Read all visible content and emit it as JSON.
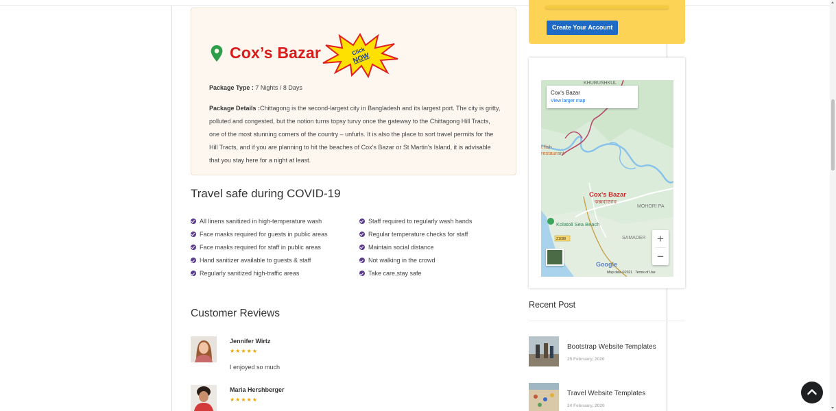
{
  "package": {
    "name": "Cox’s Bazar",
    "click_now_badge": "Click NOW",
    "type_label": "Package Type :",
    "type_value": "7 Nights / 8 Days",
    "details_label": "Package Details :",
    "details_text": "Chittagong is the second-largest city in Bangladesh and its largest port. The city is gritty, polluted and congested, but the notion turns topsy turvy once the gateway to the Chittagong Hill Tracts, one of the most stunning corners of the country – unfurls. It is also the place to sort travel permits for the Hill Tracts, and if you are planning to hit the beaches of Cox's Bazar or St Martin's Island, it is advisable that you stay here for a night at least."
  },
  "covid": {
    "title": "Travel safe during COVID-19",
    "left": [
      "All linens sanitized in high-temperature wash",
      "Face masks required for guests in public areas",
      "Face masks required for staff in public areas",
      "Hand sanitizer available to guests & staff",
      "Regularly sanitized high-traffic areas"
    ],
    "right": [
      "Staff required to regularly wash hands",
      "Regular temperature checks for staff",
      "Maintain social distance",
      "Not walking in the crowd",
      "Take care,stay safe"
    ]
  },
  "reviews": {
    "title": "Customer Reviews",
    "items": [
      {
        "name": "Jennifer Wirtz",
        "stars": "★★★★★",
        "rating": 5,
        "text": "I enjoyed so much"
      },
      {
        "name": "Maria Hershberger",
        "stars": "★★★★★",
        "rating": 5,
        "text": ""
      }
    ]
  },
  "sidebar": {
    "create_account_label": "Create Your Account",
    "map": {
      "info_title": "Cox's Bazar",
      "info_link": "View larger map",
      "labels": {
        "khurushkul": "KHURUSHKUL",
        "fish1": "t fish",
        "fish2": "restaurant",
        "city": "Cox's Bazar",
        "city_bn": "কক্সবাজার",
        "mohori": "MOHORI PA",
        "beach": "Kolatoli Sea Beach",
        "road": "Z1098",
        "samader": "SAMADER"
      },
      "zoom_in": "+",
      "zoom_out": "−",
      "google": "Google",
      "map_data": "Map data ©2021",
      "terms": "Terms of Use"
    },
    "recent_title": "Recent Post",
    "posts": [
      {
        "title": "Bootstrap Website Templates",
        "date": "25 February, 2020"
      },
      {
        "title": "Travel Website Templates",
        "date": "24 February, 2020"
      }
    ]
  },
  "icons": {
    "pin": "location-pin-icon",
    "check": "check-circle-icon",
    "back_to_top": "chevron-up-icon"
  },
  "colors": {
    "title_red": "#d81b1b",
    "pin_green": "#2e9e4a",
    "check_purple": "#5a3b8c",
    "account_yellow": "#fdd356",
    "button_blue": "#1e6ac4",
    "star_gold": "#f0a400"
  }
}
